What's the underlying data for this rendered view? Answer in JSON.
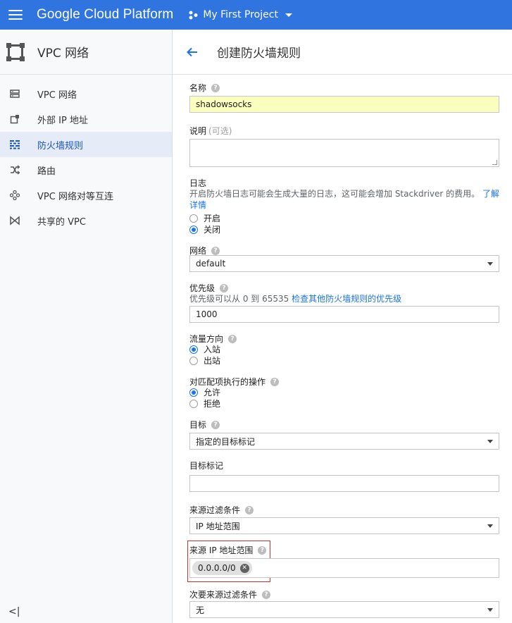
{
  "topbar": {
    "brand": "Google Cloud Platform",
    "project": "My First Project"
  },
  "sidebar": {
    "title": "VPC 网络",
    "items": [
      {
        "label": "VPC 网络",
        "icon": "vpc-network-icon"
      },
      {
        "label": "外部 IP 地址",
        "icon": "external-ip-icon"
      },
      {
        "label": "防火墙规则",
        "icon": "firewall-icon",
        "active": true
      },
      {
        "label": "路由",
        "icon": "routes-icon"
      },
      {
        "label": "VPC 网络对等互连",
        "icon": "peering-icon"
      },
      {
        "label": "共享的 VPC",
        "icon": "shared-vpc-icon"
      }
    ],
    "collapse": "<|"
  },
  "header": {
    "title": "创建防火墙规则"
  },
  "form": {
    "name": {
      "label": "名称",
      "value": "shadowsocks"
    },
    "description": {
      "label": "说明",
      "optional": "(可选)",
      "value": ""
    },
    "logs": {
      "label": "日志",
      "hint": "开启防火墙日志可能会生成大量的日志，这可能会增加 Stackdriver 的费用。",
      "link_part1": "了解",
      "link_part2": "详情",
      "options": [
        "开启",
        "关闭"
      ],
      "selected": "关闭"
    },
    "network": {
      "label": "网络",
      "value": "default"
    },
    "priority": {
      "label": "优先级",
      "hint": "优先级可以从 0 到 65535 ",
      "hint_link": "检查其他防火墙规则的优先级",
      "value": "1000"
    },
    "direction": {
      "label": "流量方向",
      "options": [
        "入站",
        "出站"
      ],
      "selected": "入站"
    },
    "action": {
      "label": "对匹配项执行的操作",
      "options": [
        "允许",
        "拒绝"
      ],
      "selected": "允许"
    },
    "targets": {
      "label": "目标",
      "value": "指定的目标标记"
    },
    "target_tags": {
      "label": "目标标记",
      "value": ""
    },
    "source_filter": {
      "label": "来源过滤条件",
      "value": "IP 地址范围"
    },
    "source_ip_ranges": {
      "label": "来源 IP 地址范围",
      "chip": "0.0.0.0/0"
    },
    "second_source_filter": {
      "label": "次要来源过滤条件",
      "value": "无"
    }
  },
  "colors": {
    "topbar": "#2f74df",
    "accent": "#1a73e8",
    "highlight": "#d32f2f",
    "autofill": "#faffbd"
  }
}
